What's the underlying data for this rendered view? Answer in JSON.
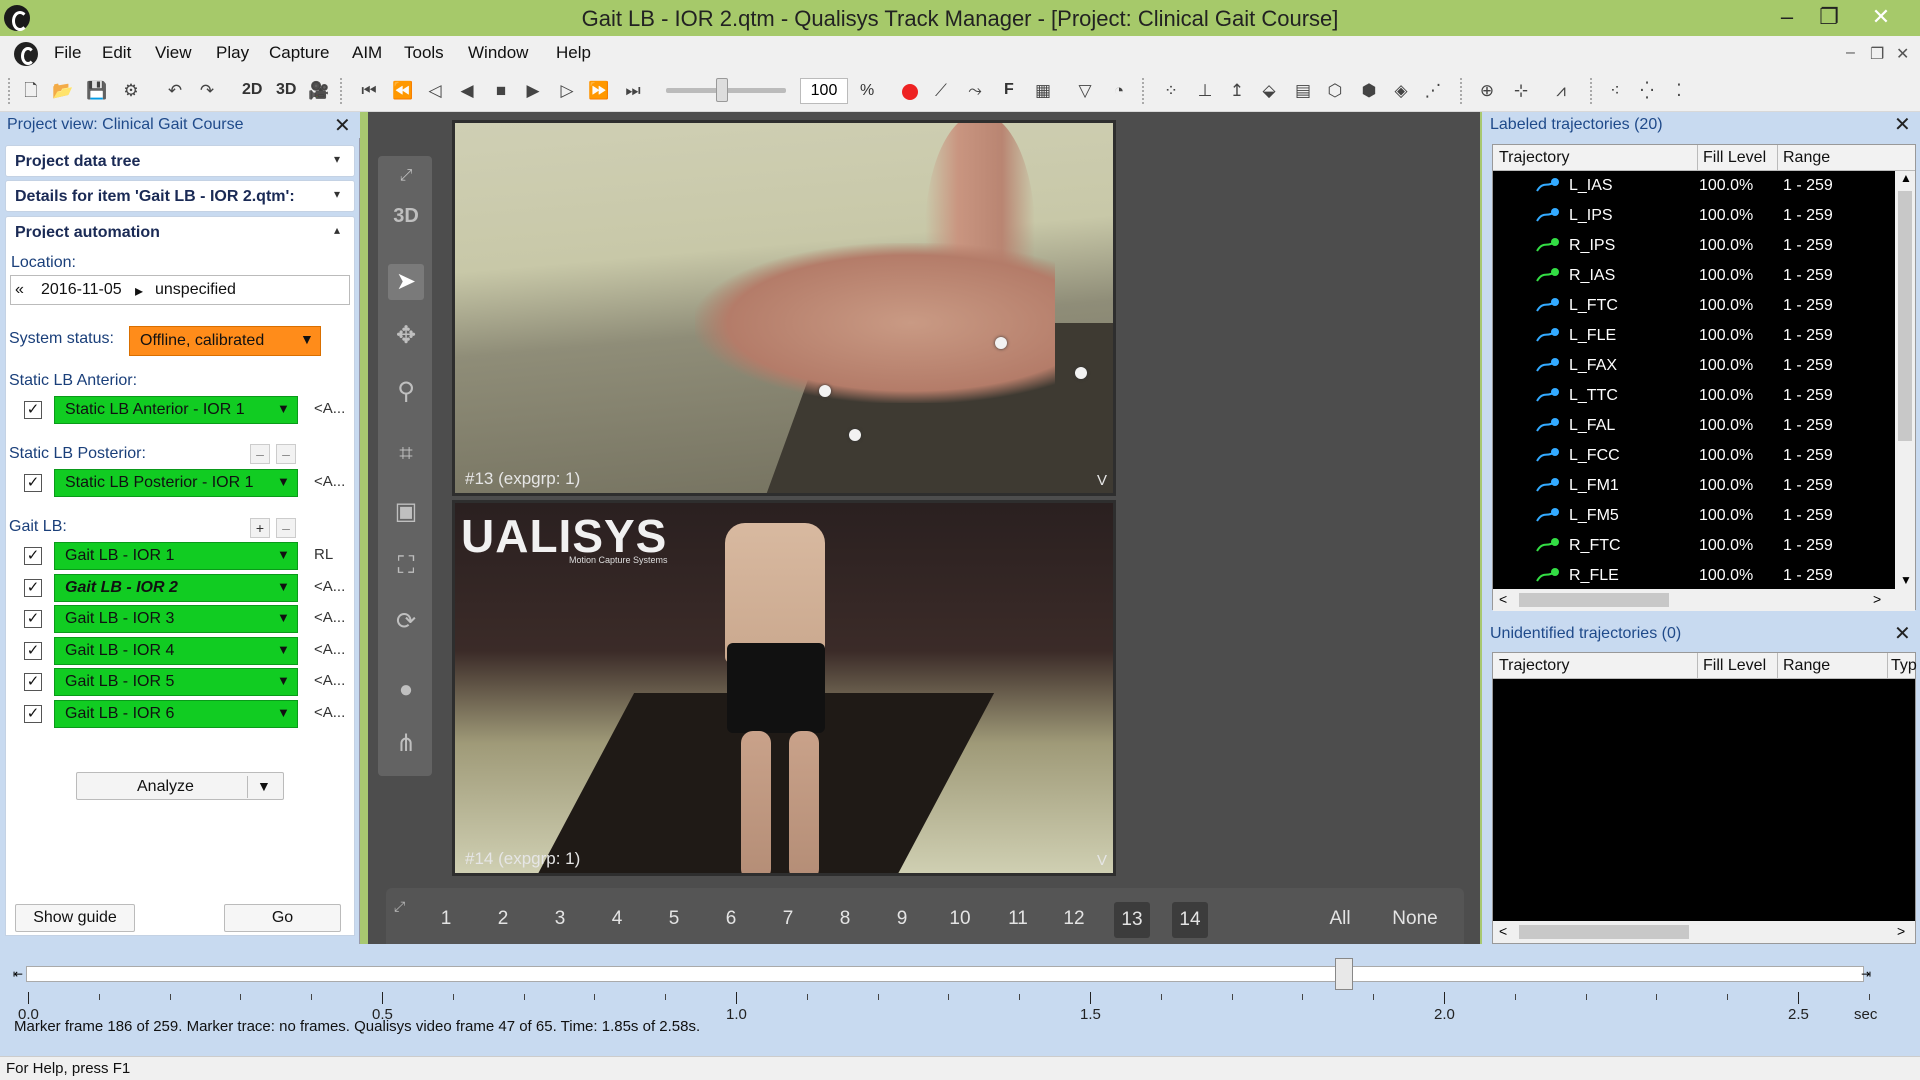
{
  "window": {
    "title": "Gait LB - IOR 2.qtm - Qualisys Track Manager - [Project: Clinical Gait Course]",
    "controls": [
      "–",
      "❐",
      "✕"
    ]
  },
  "menu": [
    "File",
    "Edit",
    "View",
    "Play",
    "Capture",
    "AIM",
    "Tools",
    "Window",
    "Help"
  ],
  "toolbar": {
    "view2d": "2D",
    "view3d": "3D",
    "speed_value": "100",
    "speed_unit": "%",
    "trace_label": "F"
  },
  "project_view": {
    "header": "Project view: Clinical Gait Course",
    "sections": {
      "data_tree": "Project data tree",
      "details": "Details for item 'Gait LB - IOR 2.qtm':",
      "automation": "Project automation"
    },
    "location_label": "Location:",
    "location": {
      "back": "«",
      "date": "2016-11-05",
      "arrow": "▸",
      "place": "unspecified"
    },
    "system_status_label": "System status:",
    "system_status": "Offline, calibrated",
    "groups": [
      {
        "label": "Static LB Anterior:",
        "items": [
          {
            "name": "Static LB Anterior - IOR 1",
            "side": "<A...",
            "checked": true
          }
        ]
      },
      {
        "label": "Static LB Posterior:",
        "items": [
          {
            "name": "Static LB Posterior - IOR 1",
            "side": "<A...",
            "checked": true
          }
        ]
      },
      {
        "label": "Gait LB:",
        "items": [
          {
            "name": "Gait LB - IOR 1",
            "side": "RL",
            "checked": true
          },
          {
            "name": "Gait LB - IOR 2",
            "side": "<A...",
            "checked": true,
            "active": true
          },
          {
            "name": "Gait LB - IOR 3",
            "side": "<A...",
            "checked": true
          },
          {
            "name": "Gait LB - IOR 4",
            "side": "<A...",
            "checked": true
          },
          {
            "name": "Gait LB - IOR 5",
            "side": "<A...",
            "checked": true
          },
          {
            "name": "Gait LB - IOR 6",
            "side": "<A...",
            "checked": true
          }
        ]
      }
    ],
    "analyze_label": "Analyze",
    "show_guide_label": "Show guide",
    "go_label": "Go"
  },
  "view_toolbar": [
    "3D"
  ],
  "cameras": {
    "views": [
      {
        "label": "#13 (expgrp: 1)",
        "corner": "V"
      },
      {
        "label": "#14 (expgrp: 1)",
        "corner": "V"
      }
    ],
    "logo": "UALISYS",
    "logo_sub": "Motion Capture Systems",
    "numbers": [
      "1",
      "2",
      "3",
      "4",
      "5",
      "6",
      "7",
      "8",
      "9",
      "10",
      "11",
      "12",
      "13",
      "14"
    ],
    "selected": [
      "13",
      "14"
    ],
    "all_label": "All",
    "none_label": "None"
  },
  "labeled_trajectories": {
    "header": "Labeled trajectories (20)",
    "columns": [
      "Trajectory",
      "Fill Level",
      "Range"
    ],
    "rows": [
      {
        "name": "L_IAS",
        "fill": "100.0%",
        "range": "1 - 259",
        "color": "#33aaff"
      },
      {
        "name": "L_IPS",
        "fill": "100.0%",
        "range": "1 - 259",
        "color": "#33aaff"
      },
      {
        "name": "R_IPS",
        "fill": "100.0%",
        "range": "1 - 259",
        "color": "#33dd44"
      },
      {
        "name": "R_IAS",
        "fill": "100.0%",
        "range": "1 - 259",
        "color": "#33dd44"
      },
      {
        "name": "L_FTC",
        "fill": "100.0%",
        "range": "1 - 259",
        "color": "#33aaff"
      },
      {
        "name": "L_FLE",
        "fill": "100.0%",
        "range": "1 - 259",
        "color": "#33aaff"
      },
      {
        "name": "L_FAX",
        "fill": "100.0%",
        "range": "1 - 259",
        "color": "#33aaff"
      },
      {
        "name": "L_TTC",
        "fill": "100.0%",
        "range": "1 - 259",
        "color": "#33aaff"
      },
      {
        "name": "L_FAL",
        "fill": "100.0%",
        "range": "1 - 259",
        "color": "#33aaff"
      },
      {
        "name": "L_FCC",
        "fill": "100.0%",
        "range": "1 - 259",
        "color": "#33aaff"
      },
      {
        "name": "L_FM1",
        "fill": "100.0%",
        "range": "1 - 259",
        "color": "#33aaff"
      },
      {
        "name": "L_FM5",
        "fill": "100.0%",
        "range": "1 - 259",
        "color": "#33aaff"
      },
      {
        "name": "R_FTC",
        "fill": "100.0%",
        "range": "1 - 259",
        "color": "#33dd44"
      },
      {
        "name": "R_FLE",
        "fill": "100.0%",
        "range": "1 - 259",
        "color": "#33dd44"
      }
    ]
  },
  "unidentified_trajectories": {
    "header": "Unidentified trajectories (0)",
    "columns": [
      "Trajectory",
      "Fill Level",
      "Range",
      "Typ"
    ]
  },
  "timeline": {
    "labels": [
      "0.0",
      "0.5",
      "1.0",
      "1.5",
      "2.0",
      "2.5"
    ],
    "unit": "sec",
    "current_time_fraction": 0.717,
    "info": "Marker frame 186 of 259. Marker trace: no frames. Qualisys video frame 47 of 65. Time: 1.85s of 2.58s."
  },
  "statusbar": "For Help, press F1"
}
